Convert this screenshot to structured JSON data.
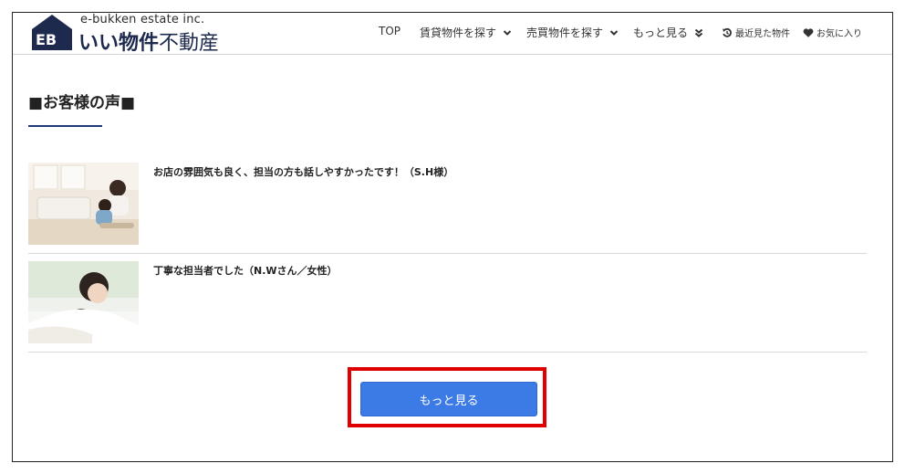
{
  "header": {
    "logo_sub": "e-bukken estate inc.",
    "logo_main_bold": "いい物件",
    "logo_main_thin": "不動産",
    "logo_mark_text": "EB",
    "nav": {
      "top": "TOP",
      "rent": "賃貸物件を探す",
      "buy": "売買物件を探す",
      "more": "もっと見る",
      "recent": "最近見た物件",
      "favorites": "お気に入り"
    }
  },
  "main": {
    "section_title": "■お客様の声■",
    "voices": [
      {
        "text": "お店の雰囲気も良く、担当の方も話しやすかったです！（S.H様）"
      },
      {
        "text": "丁寧な担当者でした（N.Wさん／女性）"
      }
    ],
    "more_button": "もっと見る"
  },
  "colors": {
    "brand_navy": "#1d2a4d",
    "accent_blue": "#3c7be6",
    "highlight_red": "#e00000"
  }
}
